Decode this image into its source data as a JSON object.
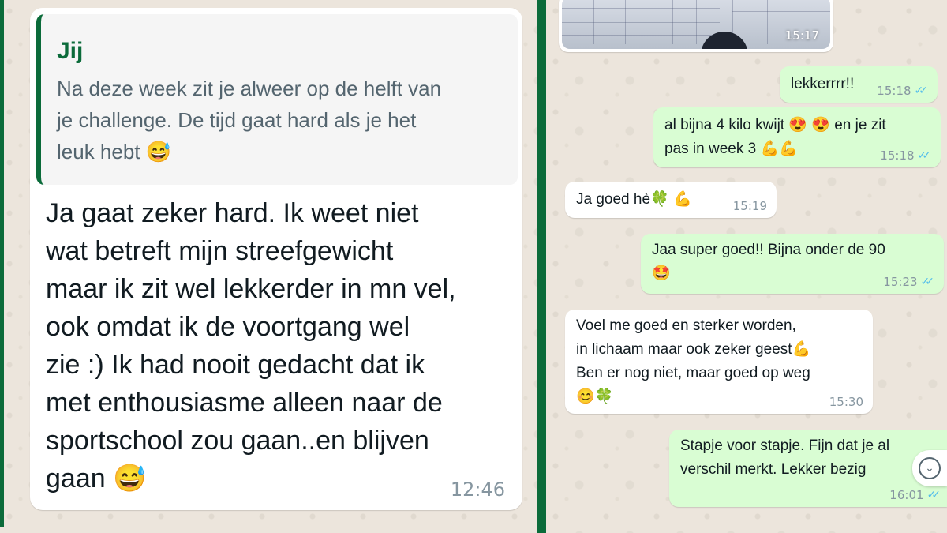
{
  "left_chat": {
    "big_message": {
      "quote_author": "Jij",
      "quote_text": "Na deze week zit je alweer op de helft van\nje challenge. De tijd gaat hard als je het\nleuk hebt 😅",
      "text": "Ja gaat zeker hard. Ik weet niet\nwat betreft mijn streefgewicht\nmaar ik zit wel lekkerder in mn vel,\nook omdat ik de voortgang wel\nzie :) Ik had nooit gedacht dat ik\nmet enthousiasme alleen naar de\nsportschool zou gaan..en blijven\ngaan 😅",
      "time": "12:46"
    }
  },
  "right_chat": {
    "image_message": {
      "time": "15:17"
    },
    "messages": [
      {
        "direction": "out",
        "text": "lekkerrrr!!",
        "time": "15:18",
        "read": true
      },
      {
        "direction": "out",
        "text": "al bijna 4 kilo kwijt 😍 😍 en je zit\npas in week 3 💪💪",
        "time": "15:18",
        "read": true
      },
      {
        "direction": "in",
        "text": "Ja goed hè🍀 💪",
        "time": "15:19"
      },
      {
        "direction": "out",
        "text": "Jaa super goed!! Bijna onder de 90\n🤩",
        "time": "15:23",
        "read": true
      },
      {
        "direction": "in",
        "text": "Voel me goed en sterker worden,\nin lichaam maar ook zeker geest💪\nBen er nog niet, maar goed op weg\n😊🍀",
        "time": "15:30"
      },
      {
        "direction": "out",
        "text": "Stapje voor stapje. Fijn dat je al\nverschil merkt. Lekker bezig",
        "time": "16:01",
        "read": true
      }
    ]
  },
  "icons": {
    "read_receipt": "double-check-icon",
    "scroll_down": "chevron-down-icon"
  },
  "colors": {
    "accent_green": "#0b6b3a",
    "outgoing_bubble": "#d9fdd3",
    "incoming_bubble": "#ffffff",
    "read_tick": "#53bdeb",
    "chat_background": "#ece5dc"
  }
}
